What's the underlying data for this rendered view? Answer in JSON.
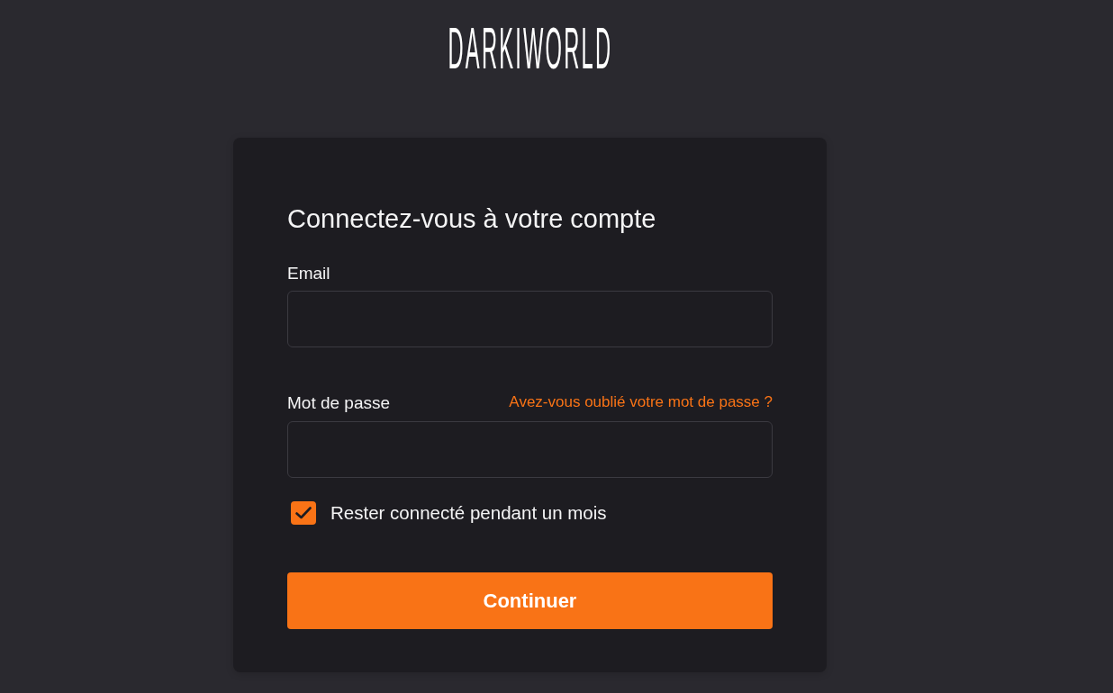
{
  "logo": {
    "text": "DARKIWORLD"
  },
  "login_form": {
    "title": "Connectez-vous à votre compte",
    "fields": [
      {
        "label": "Email"
      },
      {
        "label": "Mot de passe",
        "link": "Avez-vous oublié votre mot de passe ?"
      }
    ],
    "remember": {
      "label": "Rester connecté pendant un mois",
      "checked": true
    },
    "submit": "Continuer"
  }
}
